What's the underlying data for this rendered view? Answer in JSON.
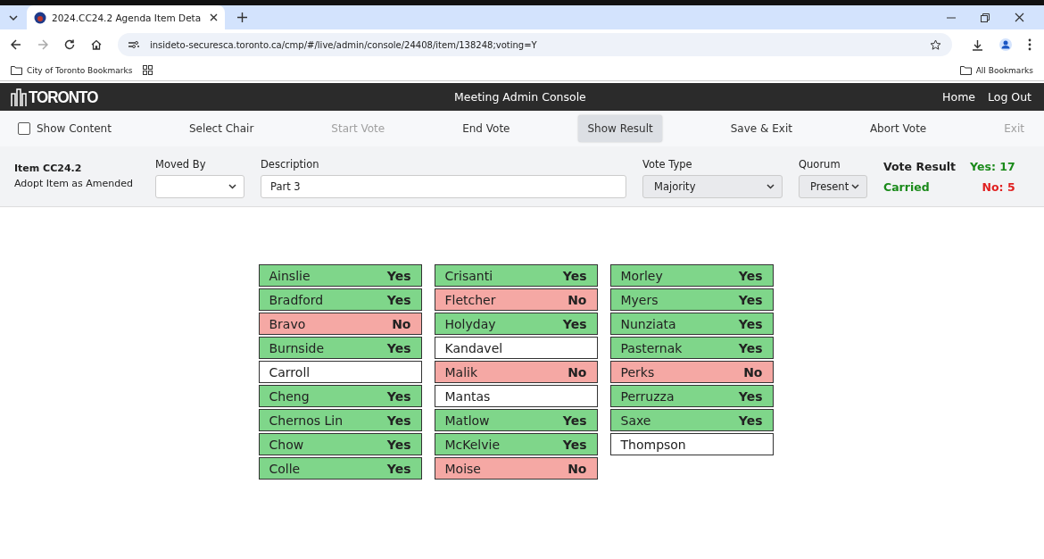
{
  "browser": {
    "tab_title": "2024.CC24.2 Agenda Item Deta",
    "url": "insideto-securesca.toronto.ca/cmp/#/live/admin/console/24408/item/138248;voting=Y",
    "bookmarks": [
      "City of Toronto Bookmarks"
    ],
    "all_bookmarks": "All Bookmarks"
  },
  "header": {
    "logo": "TORONTO",
    "title": "Meeting Admin Console",
    "links": [
      "Home",
      "Log Out"
    ]
  },
  "toolbar": [
    {
      "kind": "checkbox",
      "label": "Show Content",
      "checked": false
    },
    {
      "kind": "button",
      "label": "Select Chair",
      "disabled": false,
      "highlighted": false
    },
    {
      "kind": "button",
      "label": "Start Vote",
      "disabled": true,
      "highlighted": false
    },
    {
      "kind": "button",
      "label": "End Vote",
      "disabled": false,
      "highlighted": false
    },
    {
      "kind": "button",
      "label": "Show Result",
      "disabled": false,
      "highlighted": true
    },
    {
      "kind": "button",
      "label": "Save & Exit",
      "disabled": false,
      "highlighted": false
    },
    {
      "kind": "button",
      "label": "Abort Vote",
      "disabled": false,
      "highlighted": false
    },
    {
      "kind": "button",
      "label": "Exit",
      "disabled": true,
      "highlighted": false
    }
  ],
  "item": {
    "number": "Item CC24.2",
    "action": "Adopt Item as Amended",
    "moved_by_label": "Moved By",
    "description_label": "Description",
    "description": "Part 3",
    "vote_type_label": "Vote Type",
    "vote_type": "Majority",
    "quorum_label": "Quorum",
    "quorum": "Present",
    "result_label": "Vote Result",
    "result": "Carried",
    "yes": "Yes: 17",
    "no": "No: 5"
  },
  "members": [
    [
      {
        "name": "Ainslie",
        "kind": "yes",
        "vote": "Yes"
      },
      {
        "name": "Bradford",
        "kind": "yes",
        "vote": "Yes"
      },
      {
        "name": "Bravo",
        "kind": "no",
        "vote": "No"
      },
      {
        "name": "Burnside",
        "kind": "yes",
        "vote": "Yes"
      },
      {
        "name": "Carroll",
        "kind": "absent"
      },
      {
        "name": "Cheng",
        "kind": "yes",
        "vote": "Yes"
      },
      {
        "name": "Chernos Lin",
        "kind": "yes",
        "vote": "Yes"
      },
      {
        "name": "Chow",
        "kind": "yes",
        "vote": "Yes"
      },
      {
        "name": "Colle",
        "kind": "yes",
        "vote": "Yes"
      }
    ],
    [
      {
        "name": "Crisanti",
        "kind": "yes",
        "vote": "Yes"
      },
      {
        "name": "Fletcher",
        "kind": "no",
        "vote": "No"
      },
      {
        "name": "Holyday",
        "kind": "yes",
        "vote": "Yes"
      },
      {
        "name": "Kandavel",
        "kind": "absent"
      },
      {
        "name": "Malik",
        "kind": "no",
        "vote": "No"
      },
      {
        "name": "Mantas",
        "kind": "absent"
      },
      {
        "name": "Matlow",
        "kind": "yes",
        "vote": "Yes"
      },
      {
        "name": "McKelvie",
        "kind": "yes",
        "vote": "Yes"
      },
      {
        "name": "Moise",
        "kind": "no",
        "vote": "No"
      }
    ],
    [
      {
        "name": "Morley",
        "kind": "yes",
        "vote": "Yes"
      },
      {
        "name": "Myers",
        "kind": "yes",
        "vote": "Yes"
      },
      {
        "name": "Nunziata",
        "kind": "yes",
        "vote": "Yes"
      },
      {
        "name": "Pasternak",
        "kind": "yes",
        "vote": "Yes"
      },
      {
        "name": "Perks",
        "kind": "no",
        "vote": "No"
      },
      {
        "name": "Perruzza",
        "kind": "yes",
        "vote": "Yes"
      },
      {
        "name": "Saxe",
        "kind": "yes",
        "vote": "Yes"
      },
      {
        "name": "Thompson",
        "kind": "absent"
      }
    ]
  ]
}
